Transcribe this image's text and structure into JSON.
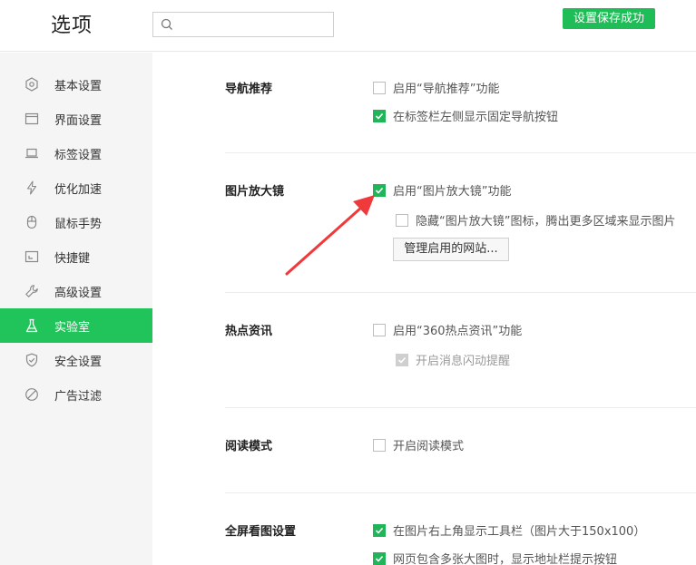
{
  "header": {
    "title": "选项",
    "search_placeholder": "",
    "toast": "设置保存成功"
  },
  "sidebar": {
    "items": [
      {
        "label": "基本设置",
        "icon": "hexagon-icon"
      },
      {
        "label": "界面设置",
        "icon": "window-icon"
      },
      {
        "label": "标签设置",
        "icon": "laptop-icon"
      },
      {
        "label": "优化加速",
        "icon": "lightning-icon"
      },
      {
        "label": "鼠标手势",
        "icon": "mouse-icon"
      },
      {
        "label": "快捷键",
        "icon": "keyboard-icon"
      },
      {
        "label": "高级设置",
        "icon": "wrench-icon"
      },
      {
        "label": "实验室",
        "icon": "flask-icon",
        "active": true
      },
      {
        "label": "安全设置",
        "icon": "shield-icon"
      },
      {
        "label": "广告过滤",
        "icon": "block-icon"
      }
    ]
  },
  "sections": {
    "nav_recommend": {
      "title": "导航推荐",
      "opt1": "启用“导航推荐”功能",
      "opt1_checked": false,
      "opt2": "在标签栏左侧显示固定导航按钮",
      "opt2_checked": true
    },
    "magnifier": {
      "title": "图片放大镜",
      "opt1": "启用“图片放大镜”功能",
      "opt1_checked": true,
      "opt2": "隐藏“图片放大镜”图标，腾出更多区域来显示图片",
      "opt2_checked": false,
      "manage_button": "管理启用的网站..."
    },
    "hot_news": {
      "title": "热点资讯",
      "opt1": "启用“360热点资讯”功能",
      "opt1_checked": false,
      "opt2": "开启消息闪动提醒",
      "opt2_checked": true,
      "opt2_disabled": true
    },
    "reading": {
      "title": "阅读模式",
      "opt1": "开启阅读模式",
      "opt1_checked": false
    },
    "fullscreen": {
      "title": "全屏看图设置",
      "opt1": "在图片右上角显示工具栏（图片大于150x100）",
      "opt1_checked": true,
      "opt2": "网页包含多张大图时，显示地址栏提示按钮",
      "opt2_checked": true
    }
  },
  "colors": {
    "accent": "#21c45a",
    "checkbox_checked": "#21b55a",
    "annotation_arrow": "#f0393a"
  }
}
